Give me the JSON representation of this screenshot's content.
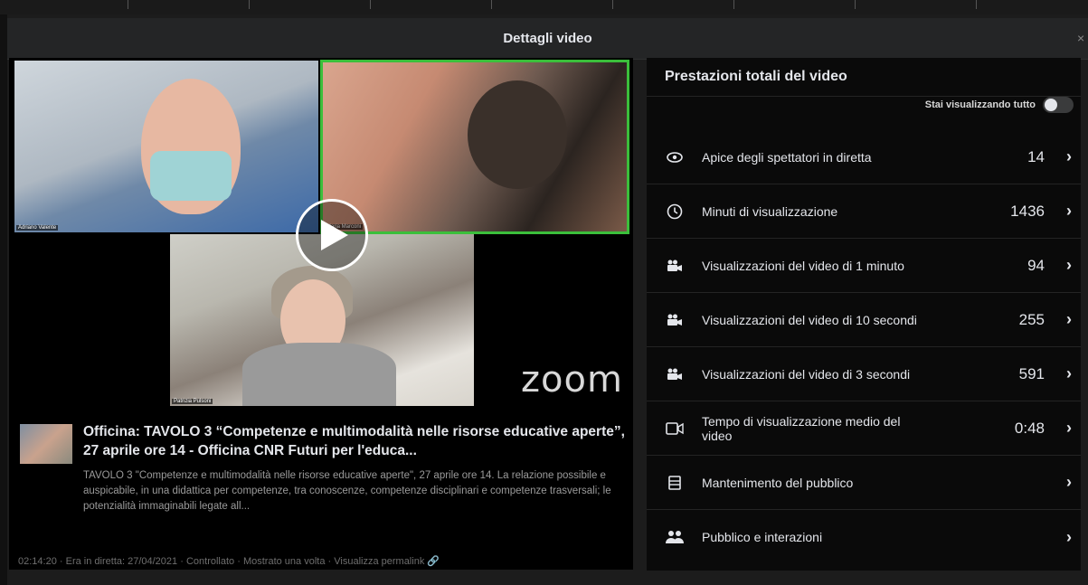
{
  "modal": {
    "title": "Dettagli video",
    "close": "×"
  },
  "video": {
    "participants": [
      "Adriano Valente",
      "Maria Marconi",
      "Patrizia Pulsoni"
    ],
    "brand": "zoom",
    "title": "Officina: TAVOLO 3 “Competenze e multimodalità nelle risorse educative aperte”, 27 aprile ore 14 - Officina CNR Futuri per l'educa...",
    "description": "TAVOLO 3 \"Competenze e multimodalità nelle risorse educative aperte\", 27 aprile ore 14. La relazione possibile e auspicabile, in una didattica per competenze, tra conoscenze, competenze disciplinari e competenze trasversali; le potenzialità immaginabili legate all...",
    "meta": {
      "duration": "02:14:20",
      "live": "Era in diretta: 27/04/2021",
      "status": "Controllato",
      "shown": "Mostrato una volta",
      "permalink": "Visualizza permalink"
    }
  },
  "stats": {
    "title": "Prestazioni totali del video",
    "view_all_label": "Stai visualizzando tutto",
    "rows": [
      {
        "icon": "eye-icon",
        "label": "Apice degli spettatori in diretta",
        "value": "14"
      },
      {
        "icon": "clock-icon",
        "label": "Minuti di visualizzazione",
        "value": "1436"
      },
      {
        "icon": "film-camera-icon",
        "label": "Visualizzazioni del video di 1 minuto",
        "value": "94"
      },
      {
        "icon": "film-camera-icon",
        "label": "Visualizzazioni del video di 10 secondi",
        "value": "255"
      },
      {
        "icon": "film-camera-icon",
        "label": "Visualizzazioni del video di 3 secondi",
        "value": "591"
      },
      {
        "icon": "video-camera-icon",
        "label": "Tempo di visualizzazione medio del video",
        "value": "0:48"
      },
      {
        "icon": "retention-icon",
        "label": "Mantenimento del pubblico",
        "value": ""
      },
      {
        "icon": "people-icon",
        "label": "Pubblico e interazioni",
        "value": ""
      }
    ],
    "chevron": "›"
  },
  "colors": {
    "active_speaker": "#3bbf3b",
    "panel_bg": "#0a0a0a",
    "modal_bg": "#242526"
  }
}
